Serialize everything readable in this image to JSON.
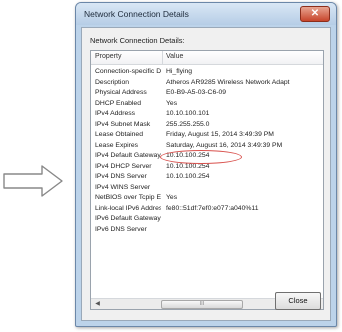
{
  "window": {
    "title": "Network Connection Details",
    "close_glyph": "✕"
  },
  "group_label": "Network Connection Details:",
  "columns": {
    "property": "Property",
    "value": "Value"
  },
  "rows": [
    {
      "property": "Connection-specific DN...",
      "value": "Hi_flying"
    },
    {
      "property": "Description",
      "value": "Atheros AR9285 Wireless Network Adapt"
    },
    {
      "property": "Physical Address",
      "value": "E0-B9-A5-03-C6-09"
    },
    {
      "property": "DHCP Enabled",
      "value": "Yes"
    },
    {
      "property": "IPv4 Address",
      "value": "10.10.100.101"
    },
    {
      "property": "IPv4 Subnet Mask",
      "value": "255.255.255.0"
    },
    {
      "property": "Lease Obtained",
      "value": "Friday, August 15, 2014 3:49:39 PM"
    },
    {
      "property": "Lease Expires",
      "value": "Saturday, August 16, 2014 3:49:39 PM"
    },
    {
      "property": "IPv4 Default Gateway",
      "value": "10.10.100.254"
    },
    {
      "property": "IPv4 DHCP Server",
      "value": "10.10.100.254"
    },
    {
      "property": "IPv4 DNS Server",
      "value": "10.10.100.254"
    },
    {
      "property": "IPv4 WINS Server",
      "value": ""
    },
    {
      "property": "NetBIOS over Tcpip En...",
      "value": "Yes"
    },
    {
      "property": "Link-local IPv6 Address",
      "value": "fe80::51df:7ef0:e077:a040%11"
    },
    {
      "property": "IPv6 Default Gateway",
      "value": ""
    },
    {
      "property": "IPv6 DNS Server",
      "value": ""
    }
  ],
  "scrollbar": {
    "left_glyph": "◀",
    "right_glyph": "▶",
    "grip_glyph": "III"
  },
  "close_button_label": "Close",
  "colors": {
    "highlight_ellipse": "#d9534f",
    "arrow": "#888888"
  }
}
